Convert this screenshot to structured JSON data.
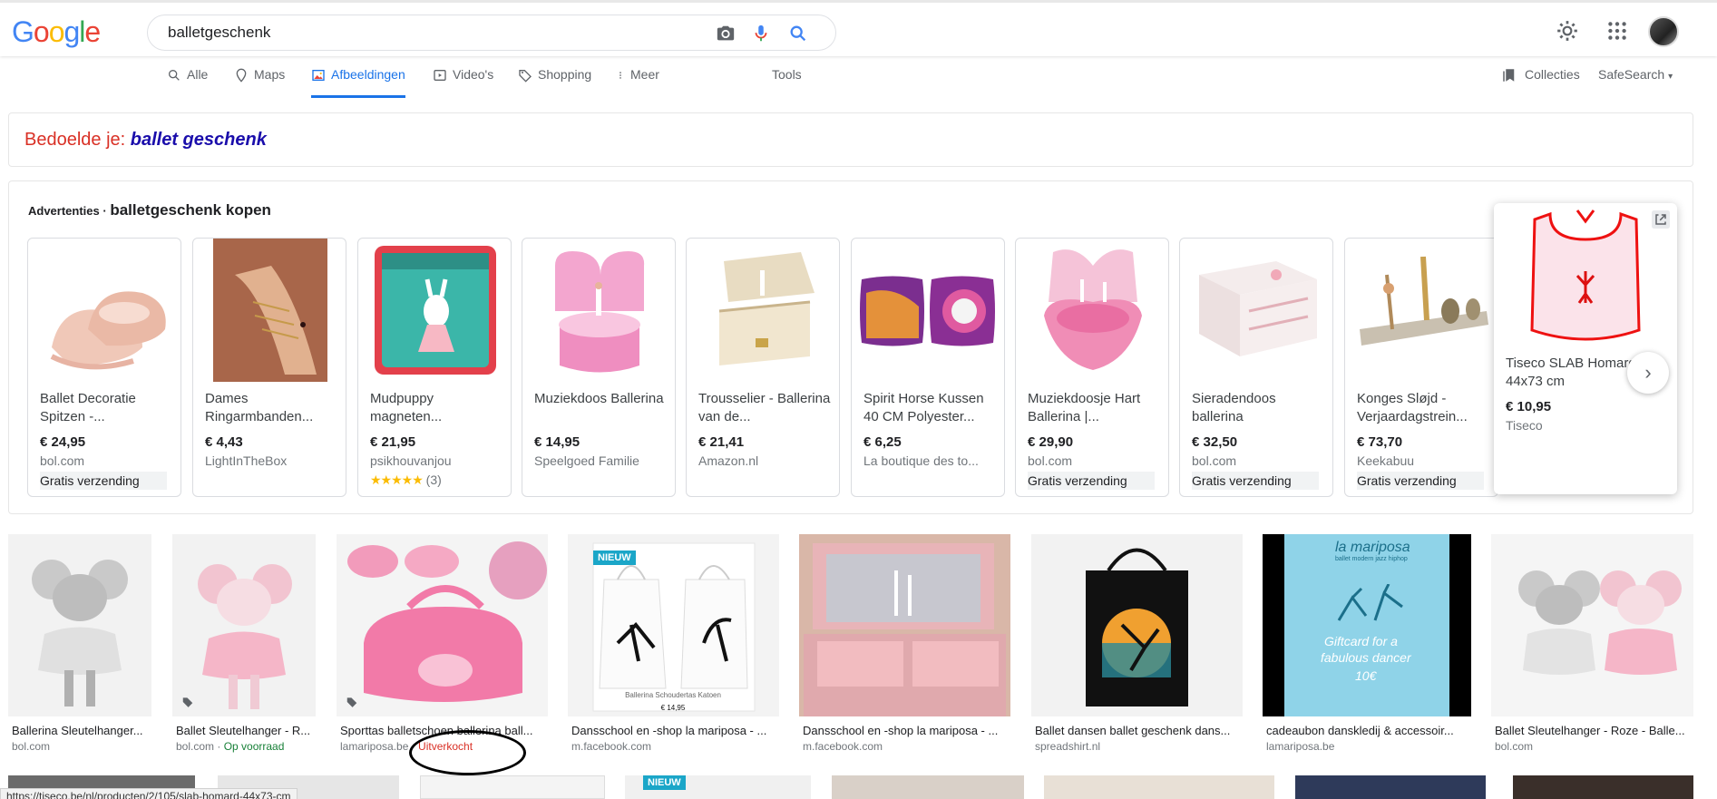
{
  "header": {
    "logo": [
      "G",
      "o",
      "o",
      "g",
      "l",
      "e"
    ],
    "search_value": "balletgeschenk"
  },
  "tabs": [
    {
      "label": "Alle"
    },
    {
      "label": "Maps"
    },
    {
      "label": "Afbeeldingen"
    },
    {
      "label": "Video's"
    },
    {
      "label": "Shopping"
    },
    {
      "label": "Meer"
    }
  ],
  "tools_label": "Tools",
  "collecties_label": "Collecties",
  "safesearch_label": "SafeSearch",
  "did_you_mean": {
    "prefix": "Bedoelde je: ",
    "suggestion": "ballet geschenk"
  },
  "ads": {
    "label": "Advertenties",
    "separator": " · ",
    "query": "balletgeschenk kopen",
    "items": [
      {
        "title": "Ballet Decoratie Spitzen -...",
        "price": "€ 24,95",
        "store": "bol.com",
        "shipping": "Gratis verzending"
      },
      {
        "title": "Dames Ringarmbanden...",
        "price": "€ 4,43",
        "store": "LightInTheBox"
      },
      {
        "title": "Mudpuppy magneten...",
        "price": "€ 21,95",
        "store": "psikhouvanjou",
        "stars": "★★★★★",
        "reviews": "(3)"
      },
      {
        "title": "Muziekdoos Ballerina",
        "price": "€ 14,95",
        "store": "Speelgoed Familie"
      },
      {
        "title": "Trousselier - Ballerina van de...",
        "price": "€ 21,41",
        "store": "Amazon.nl"
      },
      {
        "title": "Spirit Horse Kussen 40 CM Polyester...",
        "price": "€ 6,25",
        "store": "La boutique des to..."
      },
      {
        "title": "Muziekdoosje Hart Ballerina |...",
        "price": "€ 29,90",
        "store": "bol.com",
        "shipping": "Gratis verzending"
      },
      {
        "title": "Sieradendoos ballerina",
        "price": "€ 32,50",
        "store": "bol.com",
        "shipping": "Gratis verzending"
      },
      {
        "title": "Konges Sløjd - Verjaardagstrein...",
        "price": "€ 73,70",
        "store": "Keekabuu",
        "shipping": "Gratis verzending"
      },
      {
        "title": "Tiseco SLAB Homard 44x73 cm",
        "price": "€ 10,95",
        "store": "Tiseco"
      }
    ]
  },
  "images": [
    {
      "title": "Ballerina Sleutelhanger...",
      "source": "bol.com"
    },
    {
      "title": "Ballet Sleutelhanger - R...",
      "source": "bol.com",
      "stock": "Op voorraad"
    },
    {
      "title": "Sporttas balletschoen ballerina ball...",
      "source": "lamariposa.be",
      "stock_out": "Uitverkocht"
    },
    {
      "title": "Dansschool en -shop la mariposa - ...",
      "source": "m.facebook.com",
      "badge": "NIEUW",
      "caption": "Ballerina Schoudertas Katoen",
      "price": "€ 14,95"
    },
    {
      "title": "Dansschool en -shop la mariposa - ...",
      "source": "m.facebook.com"
    },
    {
      "title": "Ballet dansen ballet geschenk dans...",
      "source": "spreadshirt.nl"
    },
    {
      "title": "cadeaubon danskledij & accessoir...",
      "source": "lamariposa.be",
      "brand": "la mariposa",
      "brand_sub": "ballet modern jazz hiphop",
      "gift_line1": "Giftcard for a",
      "gift_line2": "fabulous dancer",
      "gift_amount": "10€"
    },
    {
      "title": "Ballet Sleutelhanger - Roze - Balle...",
      "source": "bol.com"
    }
  ],
  "row2_badge": "NIEUW",
  "status_url": "https://tiseco.be/nl/producten/2/105/slab-homard-44x73-cm",
  "colors": {
    "accent": "#1a73e8",
    "dym_red": "#d93025",
    "link_blue": "#1a0dab",
    "in_stock_green": "#188038"
  }
}
